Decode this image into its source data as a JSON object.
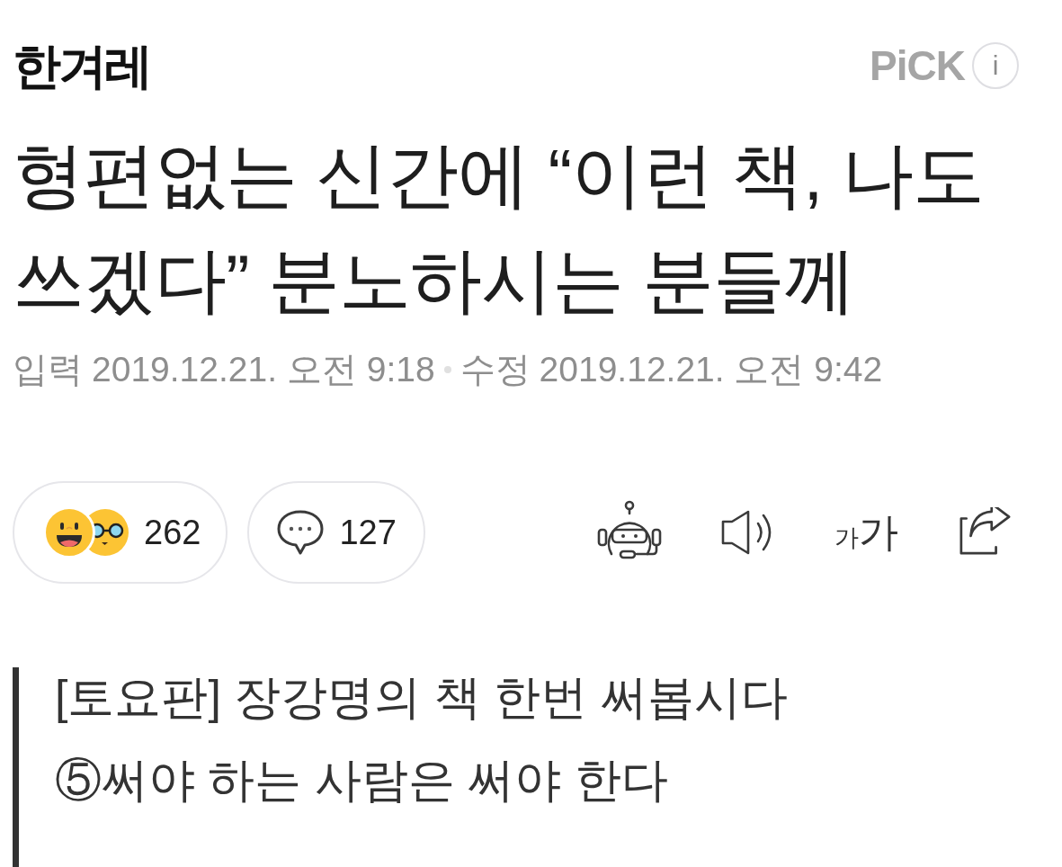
{
  "header": {
    "logo": "한겨레",
    "badge": "PiCK",
    "info_button": "i"
  },
  "headline": "형편없는 신간에 “이런 책, 나도 쓰겠다” 분노하시는 분들께",
  "meta": {
    "posted_label": "입력",
    "posted_time": "2019.12.21. 오전 9:18",
    "edited_label": "수정",
    "edited_time": "2019.12.21. 오전 9:42"
  },
  "actions": {
    "reaction_count": "262",
    "comment_count": "127",
    "font_size_button": {
      "small_label": "가",
      "large_label": "가"
    }
  },
  "summary_lines": [
    "[토요판] 장강명의 책 한번 써봅시다",
    "⑤써야 하는 사람은 써야 한다"
  ]
}
